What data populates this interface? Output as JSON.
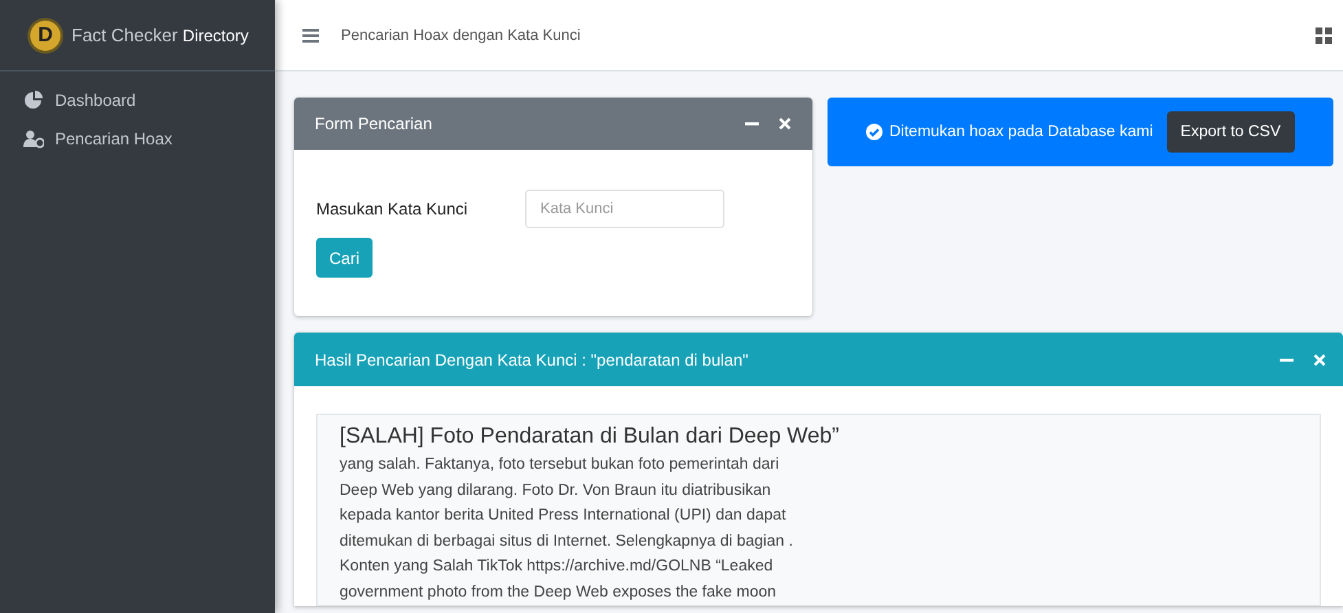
{
  "sidebar": {
    "brand": {
      "letter": "D",
      "name": "Fact Checker",
      "suffix": "Directory"
    },
    "items": [
      {
        "label": "Dashboard"
      },
      {
        "label": "Pencarian Hoax"
      }
    ]
  },
  "navbar": {
    "title": "Pencarian Hoax dengan Kata Kunci"
  },
  "form_card": {
    "title": "Form Pencarian",
    "field_label": "Masukan Kata Kunci",
    "placeholder": "Kata Kunci",
    "button": "Cari"
  },
  "alert": {
    "message": "Ditemukan hoax pada Database kami",
    "button": "Export to CSV"
  },
  "results_card": {
    "title": "Hasil Pencarian Dengan Kata Kunci : \"pendaratan di bulan\"",
    "items": [
      {
        "title": "[SALAH] Foto Pendaratan di Bulan dari Deep Web”",
        "snippet": "yang salah. Faktanya, foto tersebut bukan foto pemerintah dari Deep Web yang dilarang. Foto Dr. Von Braun itu diatribusikan kepada kantor berita United Press International (UPI) dan dapat ditemukan di berbagai situs di Internet. Selengkapnya di bagian . Konten yang Salah TikTok https://archive.md/GOLNB “Leaked government photo from the Deep Web exposes the fake moon"
      }
    ]
  }
}
